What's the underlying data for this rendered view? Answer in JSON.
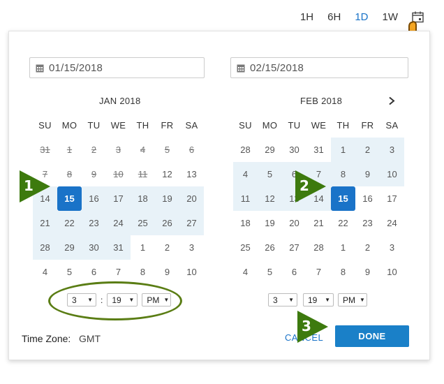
{
  "range_buttons": [
    {
      "label": "1H",
      "active": false
    },
    {
      "label": "6H",
      "active": false
    },
    {
      "label": "1D",
      "active": true
    },
    {
      "label": "1W",
      "active": false
    }
  ],
  "start": {
    "date_value": "01/15/2018",
    "month_title": "JAN 2018",
    "hour": "3",
    "minute": "19",
    "ampm": "PM"
  },
  "end": {
    "date_value": "02/15/2018",
    "month_title": "FEB 2018",
    "hour": "3",
    "minute": "19",
    "ampm": "PM"
  },
  "weekdays": [
    "SU",
    "MO",
    "TU",
    "WE",
    "TH",
    "FR",
    "SA"
  ],
  "jan_days": [
    {
      "d": "31",
      "state": "disabled"
    },
    {
      "d": "1",
      "state": "disabled"
    },
    {
      "d": "2",
      "state": "disabled"
    },
    {
      "d": "3",
      "state": "disabled"
    },
    {
      "d": "4",
      "state": "disabled"
    },
    {
      "d": "5",
      "state": "disabled"
    },
    {
      "d": "6",
      "state": "disabled"
    },
    {
      "d": "7",
      "state": "disabled"
    },
    {
      "d": "8",
      "state": "disabled"
    },
    {
      "d": "9",
      "state": "disabled"
    },
    {
      "d": "10",
      "state": "disabled"
    },
    {
      "d": "11",
      "state": "disabled"
    },
    {
      "d": "12",
      "state": ""
    },
    {
      "d": "13",
      "state": ""
    },
    {
      "d": "14",
      "state": "in-range"
    },
    {
      "d": "15",
      "state": "selected"
    },
    {
      "d": "16",
      "state": "in-range"
    },
    {
      "d": "17",
      "state": "in-range"
    },
    {
      "d": "18",
      "state": "in-range"
    },
    {
      "d": "19",
      "state": "in-range"
    },
    {
      "d": "20",
      "state": "in-range"
    },
    {
      "d": "21",
      "state": "in-range"
    },
    {
      "d": "22",
      "state": "in-range"
    },
    {
      "d": "23",
      "state": "in-range"
    },
    {
      "d": "24",
      "state": "in-range"
    },
    {
      "d": "25",
      "state": "in-range"
    },
    {
      "d": "26",
      "state": "in-range"
    },
    {
      "d": "27",
      "state": "in-range"
    },
    {
      "d": "28",
      "state": "in-range"
    },
    {
      "d": "29",
      "state": "in-range"
    },
    {
      "d": "30",
      "state": "in-range"
    },
    {
      "d": "31",
      "state": "in-range"
    },
    {
      "d": "1",
      "state": ""
    },
    {
      "d": "2",
      "state": ""
    },
    {
      "d": "3",
      "state": ""
    },
    {
      "d": "4",
      "state": ""
    },
    {
      "d": "5",
      "state": ""
    },
    {
      "d": "6",
      "state": ""
    },
    {
      "d": "7",
      "state": ""
    },
    {
      "d": "8",
      "state": ""
    },
    {
      "d": "9",
      "state": ""
    },
    {
      "d": "10",
      "state": ""
    }
  ],
  "feb_days": [
    {
      "d": "28",
      "state": ""
    },
    {
      "d": "29",
      "state": ""
    },
    {
      "d": "30",
      "state": ""
    },
    {
      "d": "31",
      "state": ""
    },
    {
      "d": "1",
      "state": "in-range"
    },
    {
      "d": "2",
      "state": "in-range"
    },
    {
      "d": "3",
      "state": "in-range"
    },
    {
      "d": "4",
      "state": "in-range"
    },
    {
      "d": "5",
      "state": "in-range"
    },
    {
      "d": "6",
      "state": "in-range"
    },
    {
      "d": "7",
      "state": "in-range"
    },
    {
      "d": "8",
      "state": "in-range"
    },
    {
      "d": "9",
      "state": "in-range"
    },
    {
      "d": "10",
      "state": "in-range"
    },
    {
      "d": "11",
      "state": "in-range"
    },
    {
      "d": "12",
      "state": "in-range"
    },
    {
      "d": "13",
      "state": "in-range"
    },
    {
      "d": "14",
      "state": "in-range"
    },
    {
      "d": "15",
      "state": "selected"
    },
    {
      "d": "16",
      "state": ""
    },
    {
      "d": "17",
      "state": ""
    },
    {
      "d": "18",
      "state": ""
    },
    {
      "d": "19",
      "state": ""
    },
    {
      "d": "20",
      "state": ""
    },
    {
      "d": "21",
      "state": ""
    },
    {
      "d": "22",
      "state": ""
    },
    {
      "d": "23",
      "state": ""
    },
    {
      "d": "24",
      "state": ""
    },
    {
      "d": "25",
      "state": ""
    },
    {
      "d": "26",
      "state": ""
    },
    {
      "d": "27",
      "state": ""
    },
    {
      "d": "28",
      "state": ""
    },
    {
      "d": "1",
      "state": ""
    },
    {
      "d": "2",
      "state": ""
    },
    {
      "d": "3",
      "state": ""
    },
    {
      "d": "4",
      "state": ""
    },
    {
      "d": "5",
      "state": ""
    },
    {
      "d": "6",
      "state": ""
    },
    {
      "d": "7",
      "state": ""
    },
    {
      "d": "8",
      "state": ""
    },
    {
      "d": "9",
      "state": ""
    },
    {
      "d": "10",
      "state": ""
    }
  ],
  "timezone": {
    "label": "Time Zone:",
    "value": "GMT"
  },
  "actions": {
    "cancel": "CANCEL",
    "done": "DONE"
  },
  "step_markers": [
    "1",
    "2",
    "3"
  ],
  "icons": {
    "calendar": "calendar-icon",
    "hand": "pointer-hand-icon",
    "next": "chevron-right-icon",
    "dropdown": "caret-down-icon"
  },
  "colors": {
    "accent": "#1a73c8",
    "range": "#e8f2f8",
    "marker": "#3d7a0e",
    "ellipse": "#5a7d14",
    "hand": "#f5a623"
  }
}
